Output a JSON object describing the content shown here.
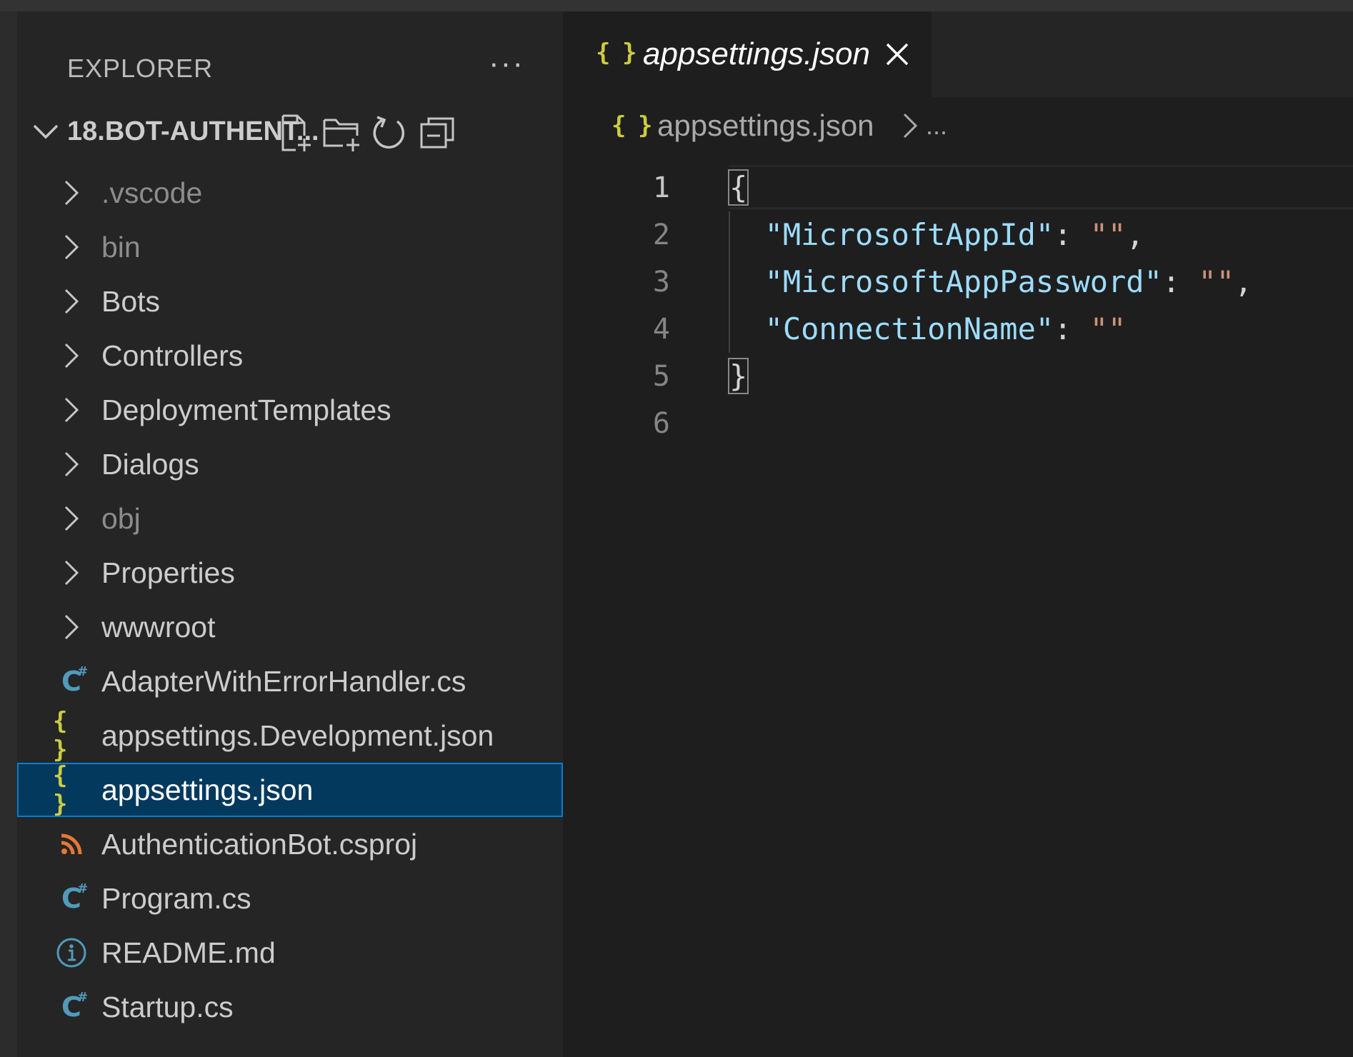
{
  "sidebar": {
    "title": "EXPLORER",
    "more_label": "···",
    "root": "18.BOT-AUTHENT...",
    "items": [
      {
        "label": ".vscode",
        "type": "folder"
      },
      {
        "label": "bin",
        "type": "folder"
      },
      {
        "label": "Bots",
        "type": "folder"
      },
      {
        "label": "Controllers",
        "type": "folder"
      },
      {
        "label": "DeploymentTemplates",
        "type": "folder"
      },
      {
        "label": "Dialogs",
        "type": "folder"
      },
      {
        "label": "obj",
        "type": "folder"
      },
      {
        "label": "Properties",
        "type": "folder"
      },
      {
        "label": "wwwroot",
        "type": "folder"
      },
      {
        "label": "AdapterWithErrorHandler.cs",
        "type": "csharp"
      },
      {
        "label": "appsettings.Development.json",
        "type": "json"
      },
      {
        "label": "appsettings.json",
        "type": "json",
        "selected": true
      },
      {
        "label": "AuthenticationBot.csproj",
        "type": "rss"
      },
      {
        "label": "Program.cs",
        "type": "csharp"
      },
      {
        "label": "README.md",
        "type": "info"
      },
      {
        "label": "Startup.cs",
        "type": "csharp"
      }
    ]
  },
  "editor": {
    "tab_title": "appsettings.json",
    "breadcrumb_file": "appsettings.json",
    "breadcrumb_more": "...",
    "json_icon": "{ }",
    "line_numbers": [
      "1",
      "2",
      "3",
      "4",
      "5",
      "6"
    ],
    "code": {
      "open_brace": "{",
      "close_brace": "}",
      "entries": [
        {
          "key": "\"MicrosoftAppId\"",
          "colon": ": ",
          "value": "\"\"",
          "comma": ","
        },
        {
          "key": "\"MicrosoftAppPassword\"",
          "colon": ": ",
          "value": "\"\"",
          "comma": ","
        },
        {
          "key": "\"ConnectionName\"",
          "colon": ": ",
          "value": "\"\"",
          "comma": ""
        }
      ]
    }
  },
  "colors": {
    "json_icon": "#cbcb41",
    "csharp_icon": "#519aba",
    "rss_icon": "#e37933",
    "selection_bg": "#04395e",
    "selection_border": "#007fd4",
    "json_key": "#9cdcfe",
    "json_string": "#ce9178"
  }
}
